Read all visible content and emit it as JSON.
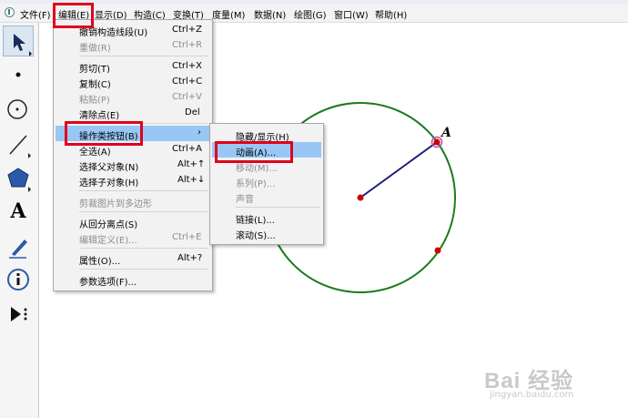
{
  "menubar": {
    "items": [
      "文件(F)",
      "编辑(E)",
      "显示(D)",
      "构造(C)",
      "变换(T)",
      "度量(M)",
      "数据(N)",
      "绘图(G)",
      "窗口(W)",
      "帮助(H)"
    ]
  },
  "canvas": {
    "point_label": "A"
  },
  "edit_menu": {
    "items": [
      {
        "label": "撤销构造线段(U)",
        "shortcut": "Ctrl+Z"
      },
      {
        "label": "重做(R)",
        "shortcut": "Ctrl+R"
      },
      {
        "label": "剪切(T)",
        "shortcut": "Ctrl+X"
      },
      {
        "label": "复制(C)",
        "shortcut": "Ctrl+C"
      },
      {
        "label": "粘贴(P)",
        "shortcut": "Ctrl+V"
      },
      {
        "label": "清除点(E)",
        "shortcut": "Del"
      },
      {
        "label": "操作类按钮(B)",
        "shortcut": "›"
      },
      {
        "label": "全选(A)",
        "shortcut": "Ctrl+A"
      },
      {
        "label": "选择父对象(N)",
        "shortcut": "Alt+↑"
      },
      {
        "label": "选择子对象(H)",
        "shortcut": "Alt+↓"
      },
      {
        "label": "剪裁图片到多边形",
        "shortcut": ""
      },
      {
        "label": "从回分离点(S)",
        "shortcut": ""
      },
      {
        "label": "编辑定义(E)...",
        "shortcut": "Ctrl+E"
      },
      {
        "label": "属性(O)...",
        "shortcut": "Alt+?"
      },
      {
        "label": "参数选项(F)...",
        "shortcut": ""
      }
    ]
  },
  "action_button_submenu": {
    "items": [
      {
        "label": "隐藏/显示(H)"
      },
      {
        "label": "动画(A)..."
      },
      {
        "label": "移动(M)..."
      },
      {
        "label": "系列(P)..."
      },
      {
        "label": "声音"
      },
      {
        "label": "链接(L)..."
      },
      {
        "label": "滚动(S)..."
      }
    ]
  },
  "watermark": {
    "brand": "Bai 经验",
    "url": "jingyan.baidu.com"
  },
  "colors": {
    "menu_selection": "#99c7f5",
    "annotation_red": "#e0001b",
    "circle_green": "#1a7a1a",
    "segment_navy": "#1a1a7a",
    "point_red": "#d00000"
  }
}
